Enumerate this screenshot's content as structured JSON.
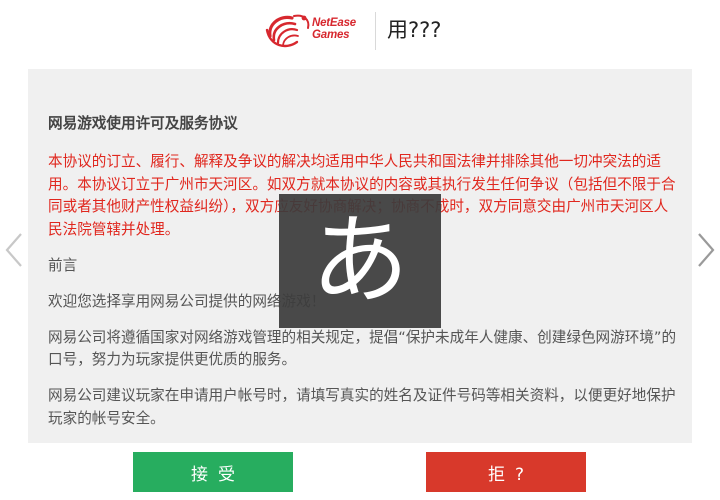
{
  "header": {
    "logo_line1": "NetEase",
    "logo_line2": "Games",
    "title": "用???"
  },
  "agreement": {
    "title": "网易游戏使用许可及服务协议",
    "red_clause": "本协议的订立、履行、解释及争议的解决均适用中华人民共和国法律并排除其他一切冲突法的适用。本协议订立于广州市天河区。如双方就本协议的内容或其执行发生任何争议（包括但不限于合同或者其他财产性权益纠纷），双方应友好协商解决；协商不成时，双方同意交由广州市天河区人民法院管辖并处理。",
    "preface_heading": "前言",
    "paragraph_1": "欢迎您选择享用网易公司提供的网络游戏！",
    "paragraph_2": "网易公司将遵循国家对网络游戏管理的相关规定，提倡“保护未成年人健康、创建绿色网游环境”的口号，努力为玩家提供更优质的服务。",
    "paragraph_3": "网易公司建议玩家在申请用户帐号时，请填写真实的姓名及证件号码等相关资料，以便更好地保护玩家的帐号安全。"
  },
  "ime": {
    "glyph": "あ"
  },
  "buttons": {
    "accept_label": "接受",
    "reject_label": "拒?"
  },
  "colors": {
    "brand_red": "#d7282f",
    "clause_red": "#e0271e",
    "accept_green": "#27ad5f",
    "reject_red": "#d8392b",
    "panel_bg": "#f0f0f0"
  },
  "icons": {
    "logo": "netease-swirl-logo",
    "left_arrow": "chevron-left-icon",
    "right_arrow": "chevron-right-icon"
  }
}
